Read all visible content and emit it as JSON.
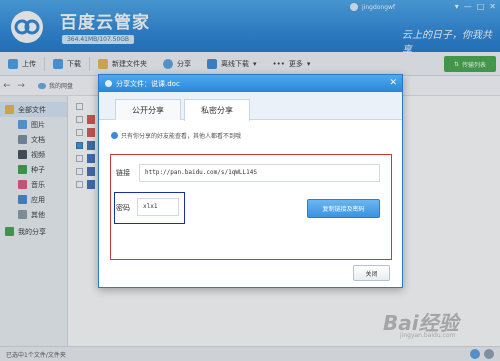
{
  "app": {
    "title": "百度云管家",
    "quota": "364.41MB/107.50GB",
    "username": "jingdongwf",
    "slogan": "云上的日子，你我共享",
    "window_buttons": [
      "▾",
      "—",
      "□",
      "✕"
    ]
  },
  "toolbar": {
    "upload": "上传",
    "download": "下载",
    "new_folder": "新建文件夹",
    "share": "分享",
    "offline": "离线下载",
    "more": "更多",
    "sync": "传输列表"
  },
  "nav": {
    "back": "←",
    "forward": "→",
    "path": "我的网盘"
  },
  "sidebar": {
    "items": [
      {
        "label": "全部文件",
        "icon": "folder-icon",
        "color": "#e8b949"
      },
      {
        "label": "图片",
        "icon": "image-icon",
        "color": "#5a9fdc"
      },
      {
        "label": "文档",
        "icon": "document-icon",
        "color": "#7b8da3"
      },
      {
        "label": "视频",
        "icon": "video-icon",
        "color": "#444c56"
      },
      {
        "label": "种子",
        "icon": "bt-icon",
        "color": "#3aa14b"
      },
      {
        "label": "音乐",
        "icon": "music-icon",
        "color": "#e0567c"
      },
      {
        "label": "应用",
        "icon": "app-icon",
        "color": "#3b8ad6"
      },
      {
        "label": "其他",
        "icon": "other-icon",
        "color": "#8a9aa8"
      },
      {
        "label": "我的分享",
        "icon": "share-icon",
        "color": "#46a04f"
      }
    ]
  },
  "status": {
    "text": "已选中1个文件/文件夹"
  },
  "dialog": {
    "title": "分享文件：说课.doc",
    "close": "✕",
    "tabs": [
      "公开分享",
      "私密分享"
    ],
    "notice": "只有你分享的好友能查看，其他人都看不到哦",
    "link_label": "链接",
    "link_value": "http://pan.baidu.com/s/1qWLL14S",
    "password_label": "密码",
    "password_value": "xlx1",
    "copy_button": "复制链接及密码",
    "close_button": "关闭"
  },
  "watermark": {
    "main": "Bai经验",
    "sub": "jingyan.baidu.com"
  },
  "colors": {
    "title_bar": "#2a86d8",
    "accent": "#3a92e0",
    "highlight_red": "#c83a3a",
    "highlight_blue": "#1d2fa0",
    "sync_green": "#43a847"
  }
}
